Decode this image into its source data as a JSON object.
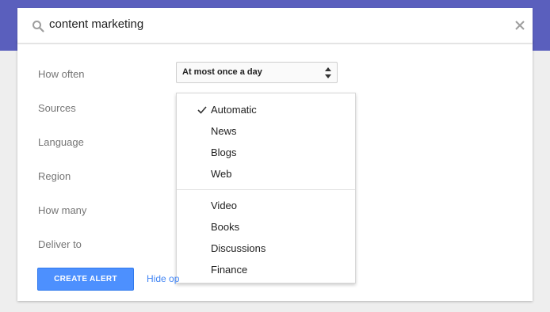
{
  "search": {
    "query": "content marketing",
    "icon": "search-icon",
    "clear_icon": "close-icon"
  },
  "options": {
    "how_often_label": "How often",
    "sources_label": "Sources",
    "language_label": "Language",
    "region_label": "Region",
    "how_many_label": "How many",
    "deliver_to_label": "Deliver to",
    "how_often_value": "At most once a day"
  },
  "sources_dropdown": {
    "selected": "Automatic",
    "items": [
      "Automatic",
      "News",
      "Blogs",
      "Web",
      "Video",
      "Books",
      "Discussions",
      "Finance"
    ]
  },
  "actions": {
    "create_label": "CREATE ALERT",
    "hide_options_label": "Hide op"
  },
  "colors": {
    "header": "#5a5fbd",
    "primary_button": "#4d90fe",
    "link": "#4285f4"
  }
}
